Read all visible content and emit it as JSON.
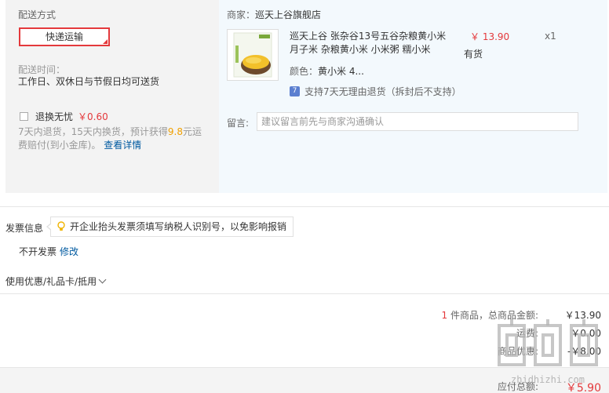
{
  "delivery": {
    "title": "配送方式",
    "method": "快递运输",
    "time_label": "配送时间：",
    "time_value": "工作日、双休日与节假日均可送货",
    "worry_name": "退换无忧",
    "worry_price": "￥0.60",
    "worry_desc_a": "7天内退货，15天内换货，预计获得",
    "worry_desc_hl": "9.8",
    "worry_desc_b": "元运费赔付(到小金库)。",
    "worry_link": "查看详情"
  },
  "order": {
    "shop_label": "商家：",
    "shop_name": "巡天上谷旗舰店",
    "product_title": "巡天上谷 张杂谷13号五谷杂粮黄小米月子米 杂粮黄小米 小米粥 糯小米",
    "price": "￥ 13.90",
    "qty": "x1",
    "stock": "有货",
    "color_label": "颜色：",
    "color_value": "黄小米 4...",
    "return_icon": "7",
    "return_text": "支持7天无理由退货（拆封后不支持）",
    "note_label": "留言:",
    "note_placeholder": "建议留言前先与商家沟通确认"
  },
  "invoice": {
    "label": "发票信息",
    "tip": "开企业抬头发票须填写纳税人识别号，以免影响报销",
    "value": "不开发票",
    "edit": "修改"
  },
  "coupon": {
    "label": "使用优惠/礼品卡/抵用"
  },
  "summary": {
    "count": "1",
    "count_label": " 件商品，总商品金额:",
    "goods_total": "￥13.90",
    "freight_label": "运费:",
    "freight": "￥0.00",
    "discount_label": "商品优惠:",
    "discount": "-￥8.00",
    "payable_label": "应付总额:",
    "payable": "￥5.90"
  },
  "watermark": {
    "site": "zhidhizhi.com"
  },
  "colors": {
    "accent": "#e4393c",
    "link": "#005aa0",
    "highlight": "#f0a000"
  }
}
